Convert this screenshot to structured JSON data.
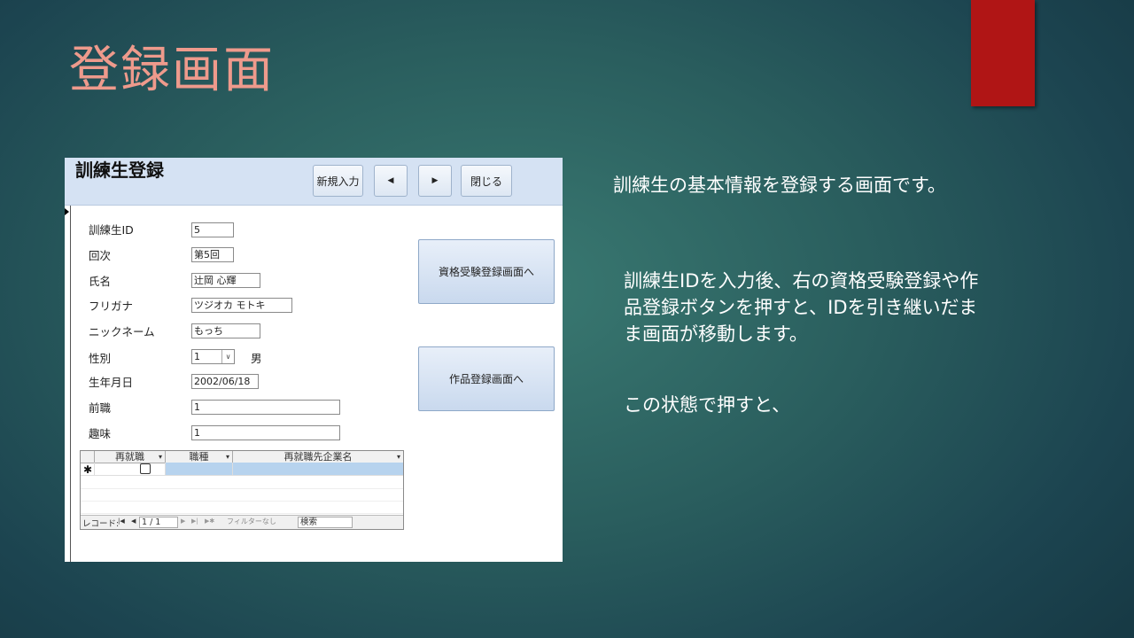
{
  "slide": {
    "title": "登録画面",
    "description1": "訓練生の基本情報を登録する画面です。",
    "description2": "訓練生IDを入力後、右の資格受験登録や作品登録ボタンを押すと、IDを引き継いだまま画面が移動します。",
    "description3": "この状態で押すと、",
    "colors": {
      "title": "#ee9a8c",
      "accent_tab": "#b01515"
    }
  },
  "form": {
    "title": "訓練生登録",
    "buttons": {
      "new": "新規入力",
      "prev": "◀",
      "next": "▶",
      "close": "閉じる"
    },
    "fields": {
      "trainee_id": {
        "label": "訓練生ID",
        "value": "5"
      },
      "term": {
        "label": "回次",
        "value": "第5回"
      },
      "name": {
        "label": "氏名",
        "value": "辻岡  心輝"
      },
      "furigana": {
        "label": "フリガナ",
        "value": "ツジオカ モトキ"
      },
      "nickname": {
        "label": "ニックネーム",
        "value": "もっち"
      },
      "gender": {
        "label": "性別",
        "value": "1",
        "text": "男"
      },
      "birthdate": {
        "label": "生年月日",
        "value": "2002/06/18"
      },
      "previous_job": {
        "label": "前職",
        "value": "1"
      },
      "hobby": {
        "label": "趣味",
        "value": "1"
      }
    },
    "side_buttons": {
      "qualification": "資格受験登録画面へ",
      "works": "作品登録画面へ"
    },
    "subform": {
      "columns": [
        "再就職",
        "職種",
        "再就職先企業名"
      ],
      "new_record_marker": "✱",
      "nav": {
        "label": "レコード:",
        "first": "|◀",
        "prev": "◀",
        "counter": "1 / 1",
        "next": "▶",
        "last": "▶|",
        "new": "▶✱",
        "filter": "フィルターなし",
        "search": "検索"
      }
    }
  }
}
